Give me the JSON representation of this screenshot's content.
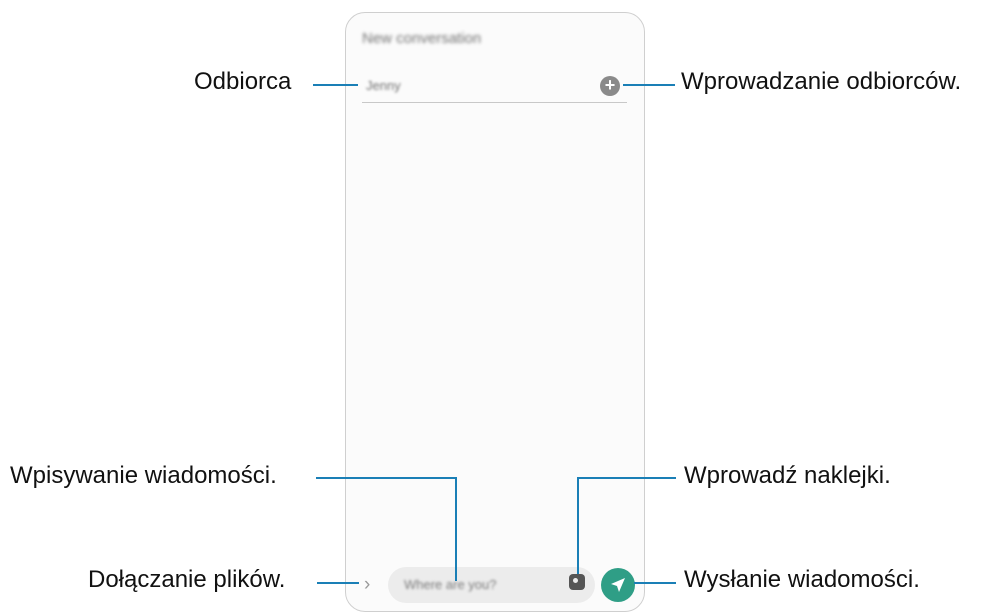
{
  "screen": {
    "title": "New conversation",
    "recipient_value": "Jenny",
    "message_placeholder": "Where are you?"
  },
  "annotations": {
    "recipient": "Odbiorca",
    "add_recipients": "Wprowadzanie odbiorców.",
    "message_input": "Wpisywanie wiadomości.",
    "stickers": "Wprowadź naklejki.",
    "attach_files": "Dołączanie plików.",
    "send": "Wysłanie wiadomości."
  },
  "icons": {
    "add": "plus-circle-icon",
    "attach": "chevron-right-icon",
    "sticker": "sticker-icon",
    "send": "paper-plane-icon"
  },
  "colors": {
    "callout_line": "#1a7fb6",
    "send_button": "#2f9e86"
  }
}
